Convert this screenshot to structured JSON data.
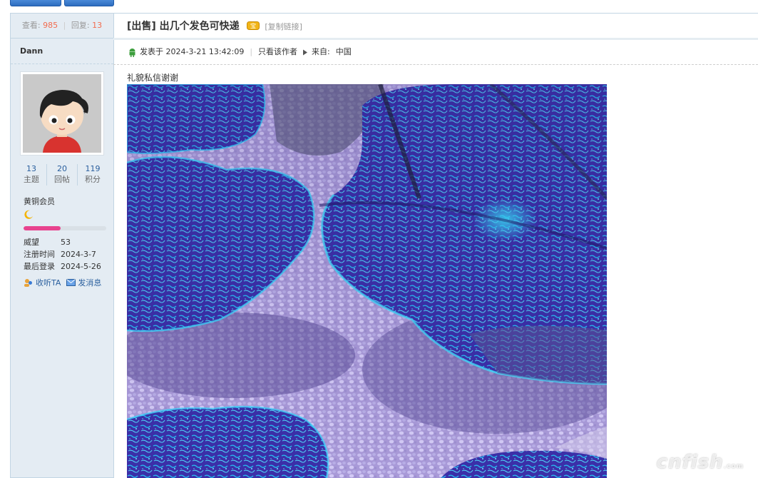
{
  "stats": {
    "views_label": "查看:",
    "views": "985",
    "separator": "|",
    "replies_label": "回复:",
    "replies": "13"
  },
  "author": {
    "name": "Dann",
    "counts": [
      {
        "value": "13",
        "label": "主题"
      },
      {
        "value": "20",
        "label": "回帖"
      },
      {
        "value": "119",
        "label": "积分"
      }
    ],
    "rank": "黄铜会员",
    "rank_progress": 0.45,
    "info": [
      {
        "key": "威望",
        "value": "53"
      },
      {
        "key": "注册时间",
        "value": "2024-3-7"
      },
      {
        "key": "最后登录",
        "value": "2024-5-26"
      }
    ],
    "follow_label": "收听TA",
    "message_label": "发消息"
  },
  "thread": {
    "title": "[出售] 出几个发色可快递",
    "copy_link": "[复制链接]"
  },
  "post": {
    "posted_at": "发表于 2024-3-21 13:42:09",
    "only_author": "只看该作者",
    "from_label": "来自:",
    "from_value": "中国",
    "text": "礼貌私信谢谢"
  },
  "watermark": {
    "brand": "cnfish",
    "suffix": ".com"
  },
  "colors": {
    "sidebar_bg": "#e4ecf3",
    "border": "#c2d5e3",
    "highlight_number": "#f26c4f",
    "link": "#2a5f9e",
    "progress_fill": "#e8438e"
  },
  "icons": [
    "android-icon",
    "triangle-right-icon",
    "moon-icon",
    "follow-icon",
    "mail-icon",
    "treasure-badge-icon"
  ]
}
